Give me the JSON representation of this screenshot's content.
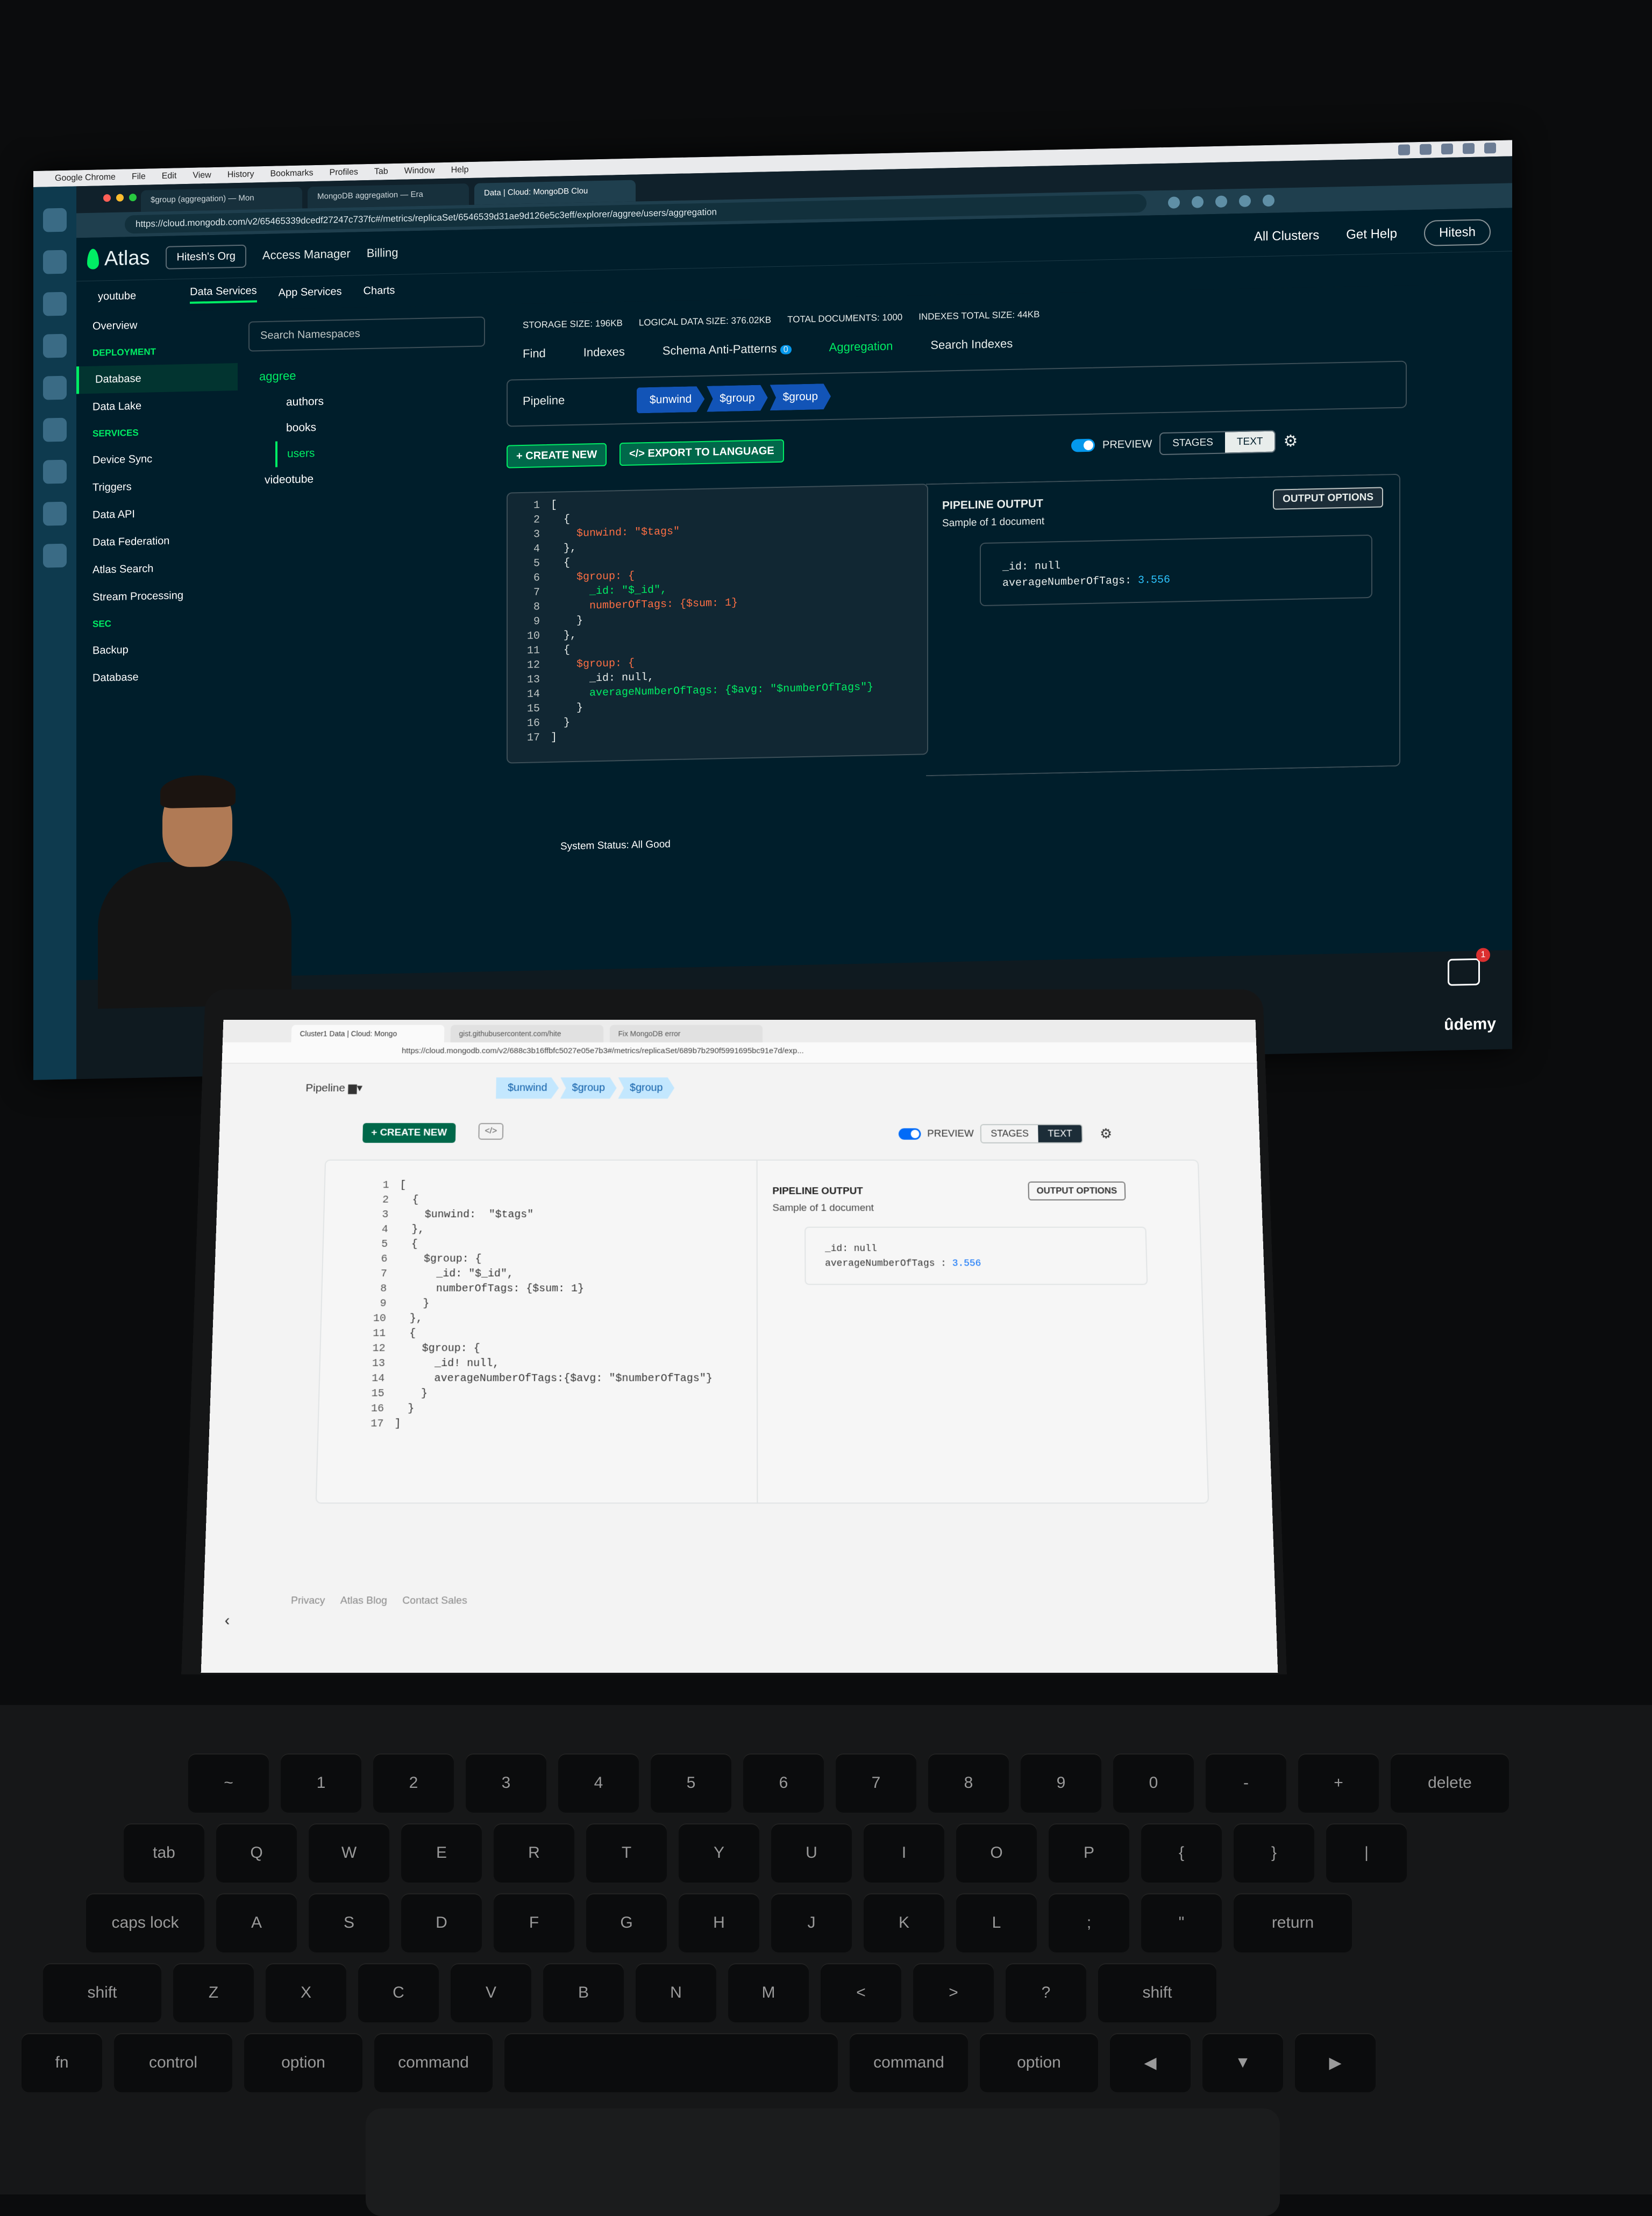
{
  "monitor": {
    "mac_menu": [
      "Google Chrome",
      "File",
      "Edit",
      "View",
      "History",
      "Bookmarks",
      "Profiles",
      "Tab",
      "Window",
      "Help"
    ],
    "tabs": [
      "$group (aggregation) — Mon",
      "MongoDB aggregation — Era",
      "Data | Cloud: MongoDB Clou"
    ],
    "url": "https://cloud.mongodb.com/v2/65465339dcedf27247c737fc#/metrics/replicaSet/6546539d31ae9d126e5c3eff/explorer/aggree/users/aggregation",
    "atlas": {
      "logo": "Atlas",
      "org": "Hitesh's Org",
      "nav": [
        "Access Manager",
        "Billing"
      ],
      "right": [
        "All Clusters",
        "Get Help",
        "Hitesh"
      ]
    },
    "project": "youtube",
    "services": [
      "Data Services",
      "App Services",
      "Charts"
    ],
    "sidebar": {
      "overview": "Overview",
      "deployment": "DEPLOYMENT",
      "items1": [
        "Database",
        "Data Lake"
      ],
      "services": "SERVICES",
      "items2": [
        "Device Sync",
        "Triggers",
        "Data API",
        "Data Federation",
        "Atlas Search",
        "Stream Processing"
      ],
      "sec": "SEC",
      "items3": [
        "Backup",
        "Database"
      ]
    },
    "namespaces": {
      "search_placeholder": "Search Namespaces",
      "db": "aggree",
      "collections": [
        "authors",
        "books",
        "users"
      ],
      "db2": "videotube"
    },
    "stats": [
      "STORAGE SIZE: 196KB",
      "LOGICAL DATA SIZE: 376.02KB",
      "TOTAL DOCUMENTS: 1000",
      "INDEXES TOTAL SIZE: 44KB"
    ],
    "tabs_main": [
      "Find",
      "Indexes",
      "Schema Anti-Patterns",
      "Aggregation",
      "Search Indexes"
    ],
    "anti_patterns_count": "0",
    "pipeline_label": "Pipeline",
    "stages": [
      "$unwind",
      "$group",
      "$group"
    ],
    "create_new": "CREATE NEW",
    "export": "EXPORT TO LANGUAGE",
    "preview": "PREVIEW",
    "stages_btn": "STAGES",
    "text_btn": "TEXT",
    "output_title": "PIPELINE OUTPUT",
    "output_sub": "Sample of 1 document",
    "output_options": "OUTPUT OPTIONS",
    "doc_line1": "_id: null",
    "doc_key2": "averageNumberOfTags: ",
    "doc_val2": "3.556",
    "status": "System Status: All Good",
    "brand": "ûdemy"
  },
  "code": [
    {
      "n": "1",
      "t": "["
    },
    {
      "n": "2",
      "t": "  {"
    },
    {
      "n": "3",
      "t": "    $unwind: \"$tags\""
    },
    {
      "n": "4",
      "t": "  },"
    },
    {
      "n": "5",
      "t": "  {"
    },
    {
      "n": "6",
      "t": "    $group: {"
    },
    {
      "n": "7",
      "t": "      _id: \"$_id\","
    },
    {
      "n": "8",
      "t": "      numberOfTags: {$sum: 1}"
    },
    {
      "n": "9",
      "t": "    }"
    },
    {
      "n": "10",
      "t": "  },"
    },
    {
      "n": "11",
      "t": "  {"
    },
    {
      "n": "12",
      "t": "    $group: {"
    },
    {
      "n": "13",
      "t": "      _id: null,"
    },
    {
      "n": "14",
      "t": "      averageNumberOfTags: {$avg: \"$numberOfTags\"}"
    },
    {
      "n": "15",
      "t": "    }"
    },
    {
      "n": "16",
      "t": "  }"
    },
    {
      "n": "17",
      "t": "]"
    }
  ],
  "laptop": {
    "tabs": [
      "Cluster1 Data | Cloud: Mongo",
      "gist.githubusercontent.com/hite",
      "Fix MongoDB error"
    ],
    "url": "https://cloud.mongodb.com/v2/688c3b16ffbfc5027e05e7b3#/metrics/replicaSet/689b7b290f5991695bc91e7d/exp...",
    "pipeline_label": "Pipeline",
    "stages": [
      "$unwind",
      "$group",
      "$group"
    ],
    "create_new": "CREATE NEW",
    "code_btn": "</>",
    "preview": "PREVIEW",
    "stages_btn": "STAGES",
    "text_btn": "TEXT",
    "output_title": "PIPELINE OUTPUT",
    "output_sub": "Sample of 1 document",
    "output_options": "OUTPUT OPTIONS",
    "doc_line1": "_id: null",
    "doc_key2": "averageNumberOfTags : ",
    "doc_val2": "3.556",
    "footer": [
      "Privacy",
      "Atlas Blog",
      "Contact Sales"
    ],
    "back": "‹"
  },
  "laptop_code": [
    {
      "n": "1",
      "t": "["
    },
    {
      "n": "2",
      "t": "  {"
    },
    {
      "n": "3",
      "t": "    $unwind:  \"$tags\""
    },
    {
      "n": "4",
      "t": "  },"
    },
    {
      "n": "5",
      "t": "  {"
    },
    {
      "n": "6",
      "t": "    $group: {"
    },
    {
      "n": "7",
      "t": "      _id: \"$_id\","
    },
    {
      "n": "8",
      "t": "      numberOfTags: {$sum: 1}"
    },
    {
      "n": "9",
      "t": "    }"
    },
    {
      "n": "10",
      "t": "  },"
    },
    {
      "n": "11",
      "t": "  {"
    },
    {
      "n": "12",
      "t": "    $group: {"
    },
    {
      "n": "13",
      "t": "      _id! null,"
    },
    {
      "n": "14",
      "t": "      averageNumberOfTags:{$avg: \"$numberOfTags\"}"
    },
    {
      "n": "15",
      "t": "    }"
    },
    {
      "n": "16",
      "t": "  }"
    },
    {
      "n": "17",
      "t": "]"
    }
  ],
  "keyboard": {
    "row1": [
      "~",
      "1",
      "2",
      "3",
      "4",
      "5",
      "6",
      "7",
      "8",
      "9",
      "0",
      "-",
      "+",
      "delete"
    ],
    "row2": [
      "tab",
      "Q",
      "W",
      "E",
      "R",
      "T",
      "Y",
      "U",
      "I",
      "O",
      "P",
      "{",
      "}",
      "|"
    ],
    "row3": [
      "caps lock",
      "A",
      "S",
      "D",
      "F",
      "G",
      "H",
      "J",
      "K",
      "L",
      ";",
      "\"",
      "return"
    ],
    "row4": [
      "shift",
      "Z",
      "X",
      "C",
      "V",
      "B",
      "N",
      "M",
      "<",
      ">",
      "?",
      "shift"
    ],
    "row5": [
      "fn",
      "control",
      "option",
      "command",
      "",
      "command",
      "option",
      "◀",
      "▼",
      "▶"
    ]
  }
}
